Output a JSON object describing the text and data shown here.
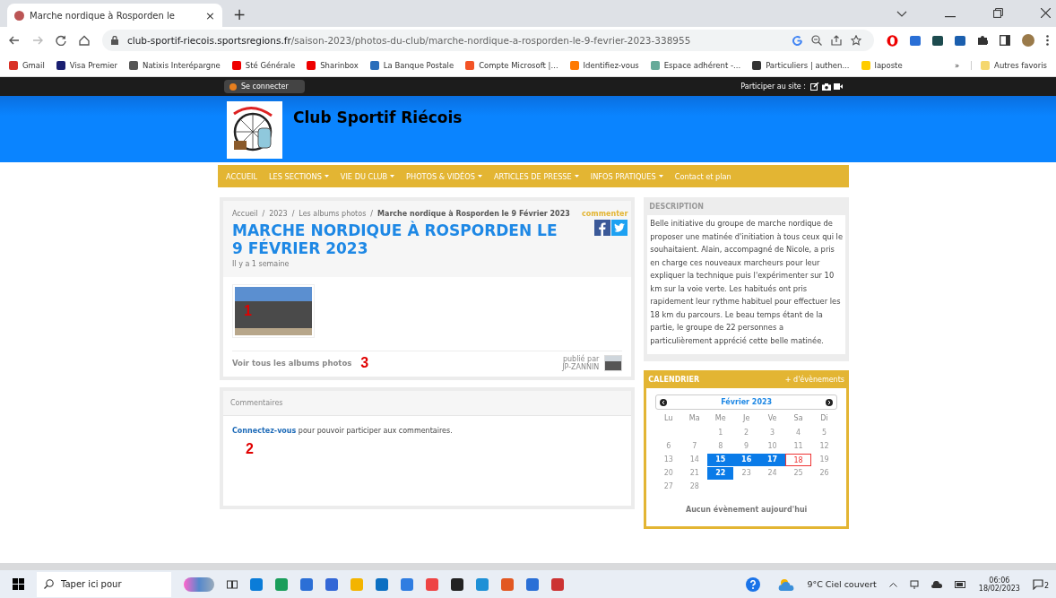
{
  "browser": {
    "tab_title": "Marche nordique à Rosporden le",
    "tab_close": "×",
    "new_tab": "+",
    "url_host": "club-sportif-riecois.sportsregions.fr",
    "url_path": "/saison-2023/photos-du-club/marche-nordique-a-rosporden-le-9-fevrier-2023-338955",
    "bookmarks": [
      "Gmail",
      "Visa Premier",
      "Natixis Interépargne",
      "Sté Générale",
      "Sharinbox",
      "La Banque Postale",
      "Compte Microsoft |...",
      "Identifiez-vous",
      "Espace adhérent -...",
      "Particuliers | authen...",
      "laposte"
    ],
    "more_bookmarks": "»",
    "other_favorites": "Autres favoris"
  },
  "topbar": {
    "login": "Se connecter",
    "participate": "Participer au site :"
  },
  "site": {
    "title": "Club Sportif Riécois"
  },
  "nav": [
    {
      "label": "ACCUEIL",
      "dropdown": false
    },
    {
      "label": "LES SECTIONS",
      "dropdown": true
    },
    {
      "label": "VIE DU CLUB",
      "dropdown": true
    },
    {
      "label": "PHOTOS & VIDÉOS",
      "dropdown": true
    },
    {
      "label": "ARTICLES DE PRESSE",
      "dropdown": true
    },
    {
      "label": "INFOS PRATIQUES",
      "dropdown": true
    },
    {
      "label": "Contact et plan",
      "dropdown": false
    }
  ],
  "article": {
    "breadcrumb_separator": "/",
    "breadcrumb": [
      "Accueil",
      "2023",
      "Les albums photos",
      "Marche nordique à Rosporden le 9 Février 2023"
    ],
    "title": "MARCHE NORDIQUE À ROSPORDEN LE 9 FÉVRIER 2023",
    "age": "Il y a 1 semaine",
    "comment": "commenter",
    "all_albums": "Voir tous les albums photos",
    "published_by": "publié par",
    "author": "JP-ZANNIN"
  },
  "comments": {
    "title": "Commentaires",
    "login_link": "Connectez-vous",
    "login_text": " pour pouvoir participer aux commentaires."
  },
  "description": {
    "title": "DESCRIPTION",
    "text": "Belle initiative du groupe de marche nordique de proposer une matinée d'initiation à tous ceux qui le souhaitaient. Alain, accompagné de Nicole, a pris en charge ces nouveaux marcheurs pour leur expliquer la technique puis l'expérimenter sur 10 km sur la voie verte. Les habitués ont pris rapidement leur rythme habituel pour effectuer les 18 km du parcours. Le beau temps étant de la partie, le groupe de 22 personnes a particulièrement apprécié cette belle matinée."
  },
  "calendar": {
    "title": "CALENDRIER",
    "more": "+ d'évènements",
    "month": "Février 2023",
    "weekdays": [
      "Lu",
      "Ma",
      "Me",
      "Je",
      "Ve",
      "Sa",
      "Di"
    ],
    "weeks": [
      [
        {
          "day": "1",
          "event": false,
          "today": false
        },
        {
          "day": "2",
          "event": false,
          "today": false
        },
        {
          "day": "3",
          "event": false,
          "today": false
        },
        {
          "day": "4",
          "event": false,
          "today": false
        },
        {
          "day": "5",
          "event": false,
          "today": false
        }
      ],
      [
        {
          "day": "6",
          "event": false,
          "today": false
        },
        {
          "day": "7",
          "event": false,
          "today": false
        },
        {
          "day": "8",
          "event": false,
          "today": false
        },
        {
          "day": "9",
          "event": false,
          "today": false
        },
        {
          "day": "10",
          "event": false,
          "today": false
        },
        {
          "day": "11",
          "event": false,
          "today": false
        },
        {
          "day": "12",
          "event": false,
          "today": false
        }
      ],
      [
        {
          "day": "13",
          "event": false,
          "today": false
        },
        {
          "day": "14",
          "event": false,
          "today": false
        },
        {
          "day": "15",
          "event": true,
          "today": false
        },
        {
          "day": "16",
          "event": true,
          "today": false
        },
        {
          "day": "17",
          "event": true,
          "today": false
        },
        {
          "day": "18",
          "event": false,
          "today": true
        },
        {
          "day": "19",
          "event": false,
          "today": false
        }
      ],
      [
        {
          "day": "20",
          "event": false,
          "today": false
        },
        {
          "day": "21",
          "event": false,
          "today": false
        },
        {
          "day": "22",
          "event": true,
          "today": false
        },
        {
          "day": "23",
          "event": false,
          "today": false
        },
        {
          "day": "24",
          "event": false,
          "today": false
        },
        {
          "day": "25",
          "event": false,
          "today": false
        },
        {
          "day": "26",
          "event": false,
          "today": false
        }
      ],
      [
        {
          "day": "27",
          "event": false,
          "today": false
        },
        {
          "day": "28",
          "event": false,
          "today": false
        }
      ]
    ],
    "no_event": "Aucun évènement aujourd'hui"
  },
  "annotations": [
    "1",
    "2",
    "3"
  ],
  "taskbar": {
    "search": "Taper ici pour",
    "weather": "9°C Ciel couvert",
    "time": "06:06",
    "date": "18/02/2023",
    "notifications": "2"
  }
}
